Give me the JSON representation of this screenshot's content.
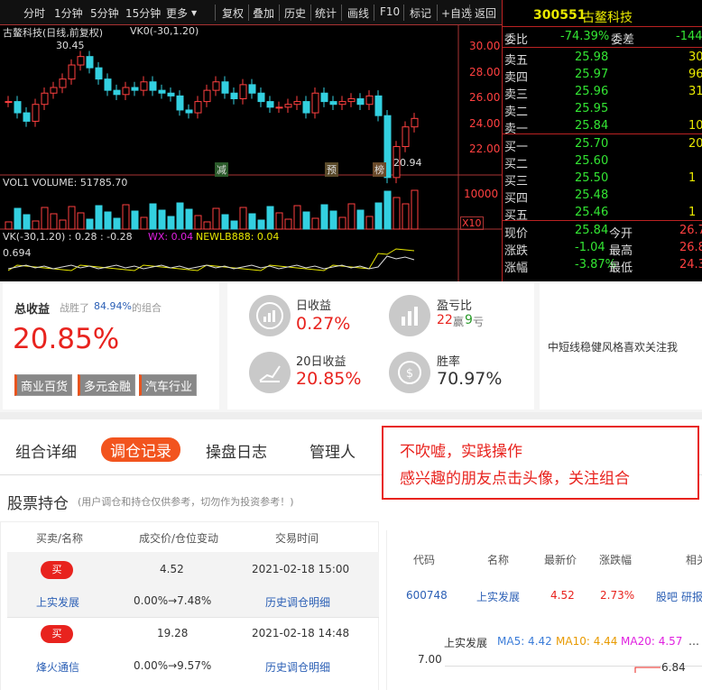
{
  "toolbar": {
    "items": [
      "分时",
      "1分钟",
      "5分钟",
      "15分钟",
      "更多",
      "复权",
      "叠加",
      "历史",
      "统计",
      "画线",
      "F10",
      "标记",
      "+自选",
      "返回"
    ],
    "more_arrow": "▼"
  },
  "chart": {
    "stock_title": "古鳌科技(日线,前复权)",
    "indicator": "VK0(-30,1.20)",
    "high_label": "30.45",
    "low_label": "20.94",
    "price_ticks": [
      "30.00",
      "28.00",
      "26.00",
      "24.00",
      "22.00"
    ],
    "event_marks": [
      "减",
      "预",
      "榜"
    ],
    "vol_legend": "VOL1 VOLUME: 51785.70",
    "vol_tick": "10000",
    "vol_unit": "X10",
    "vk_legend_1": "VK(-30,1.20) : 0.28 : -0.28",
    "vk_legend_wx": "WX: 0.04",
    "vk_legend_nl": "NEWLB888: 0.04",
    "vk_value": "0.694"
  },
  "quote": {
    "code": "300551",
    "name": "古鳌科技",
    "weibi_label": "委比",
    "weibi_value": "-74.39%",
    "weicha_label": "委差",
    "weicha_value": "-144",
    "asks": [
      {
        "label": "卖五",
        "price": "25.98",
        "vol": "30"
      },
      {
        "label": "卖四",
        "price": "25.97",
        "vol": "96"
      },
      {
        "label": "卖三",
        "price": "25.96",
        "vol": "31"
      },
      {
        "label": "卖二",
        "price": "25.95",
        "vol": ""
      },
      {
        "label": "卖一",
        "price": "25.84",
        "vol": "10"
      }
    ],
    "bids": [
      {
        "label": "买一",
        "price": "25.70",
        "vol": "20"
      },
      {
        "label": "买二",
        "price": "25.60",
        "vol": ""
      },
      {
        "label": "买三",
        "price": "25.50",
        "vol": "1"
      },
      {
        "label": "买四",
        "price": "25.48",
        "vol": ""
      },
      {
        "label": "买五",
        "price": "25.46",
        "vol": "1"
      }
    ],
    "stats": [
      {
        "l1": "现价",
        "v1": "25.84",
        "l2": "今开",
        "v2": "26.7"
      },
      {
        "l1": "涨跌",
        "v1": "-1.04",
        "l2": "最高",
        "v2": "26.8"
      },
      {
        "l1": "涨幅",
        "v1": "-3.87%",
        "l2": "最低",
        "v2": "24.3"
      }
    ]
  },
  "summary": {
    "total_label": "总收益",
    "beat_prefix": "战胜了",
    "beat_pct": "84.94%",
    "beat_suffix": "的组合",
    "total_value": "20.85%",
    "tags": [
      "商业百货",
      "多元金融",
      "汽车行业"
    ],
    "day_label": "日收益",
    "day_value": "0.27%",
    "d20_label": "20日收益",
    "d20_value": "20.85%",
    "pl_label": "盈亏比",
    "pl_win": "22",
    "pl_win_unit": "赢",
    "pl_lose": "9",
    "pl_lose_unit": "亏",
    "win_label": "胜率",
    "win_value": "70.97%",
    "desc": "中短线稳健风格喜欢关注我"
  },
  "tabs": {
    "items": [
      "组合详细",
      "调仓记录",
      "操盘日志",
      "管理人"
    ],
    "active": 1
  },
  "promo": {
    "line1": "不吹嘘，实践操作",
    "line2": "感兴趣的朋友点击头像，关注组合"
  },
  "holdings": {
    "title": "股票持仓",
    "note": "(用户调仓和持仓仅供参考，切勿作为投资参考！)",
    "headers": [
      "买卖/名称",
      "成交价/仓位变动",
      "交易时间"
    ],
    "rows": [
      {
        "action": "买",
        "price": "4.52",
        "time": "2021-02-18 15:00",
        "name": "上实发展",
        "change": "0.00%→7.48%",
        "detail": "历史调仓明细"
      },
      {
        "action": "买",
        "price": "19.28",
        "time": "2021-02-18 14:48",
        "name": "烽火通信",
        "change": "0.00%→9.57%",
        "detail": "历史调仓明细"
      }
    ]
  },
  "stock_table": {
    "headers": [
      "代码",
      "名称",
      "最新价",
      "涨跌幅",
      "相关"
    ],
    "row": {
      "code": "600748",
      "name": "上实发展",
      "price": "4.52",
      "pct": "2.73%",
      "link1": "股吧",
      "link2": "研报"
    }
  },
  "mini_chart": {
    "name": "上实发展",
    "ma5": "MA5: 4.42",
    "ma10": "MA10: 4.44",
    "ma20": "MA20: 4.57",
    "axis_top": "7.00",
    "mark": "6.84"
  },
  "colors": {
    "ma5": "#3c7dd9",
    "ma10": "#e89a00",
    "ma20": "#e020e0",
    "red": "#e8231e",
    "green": "#33e633"
  }
}
